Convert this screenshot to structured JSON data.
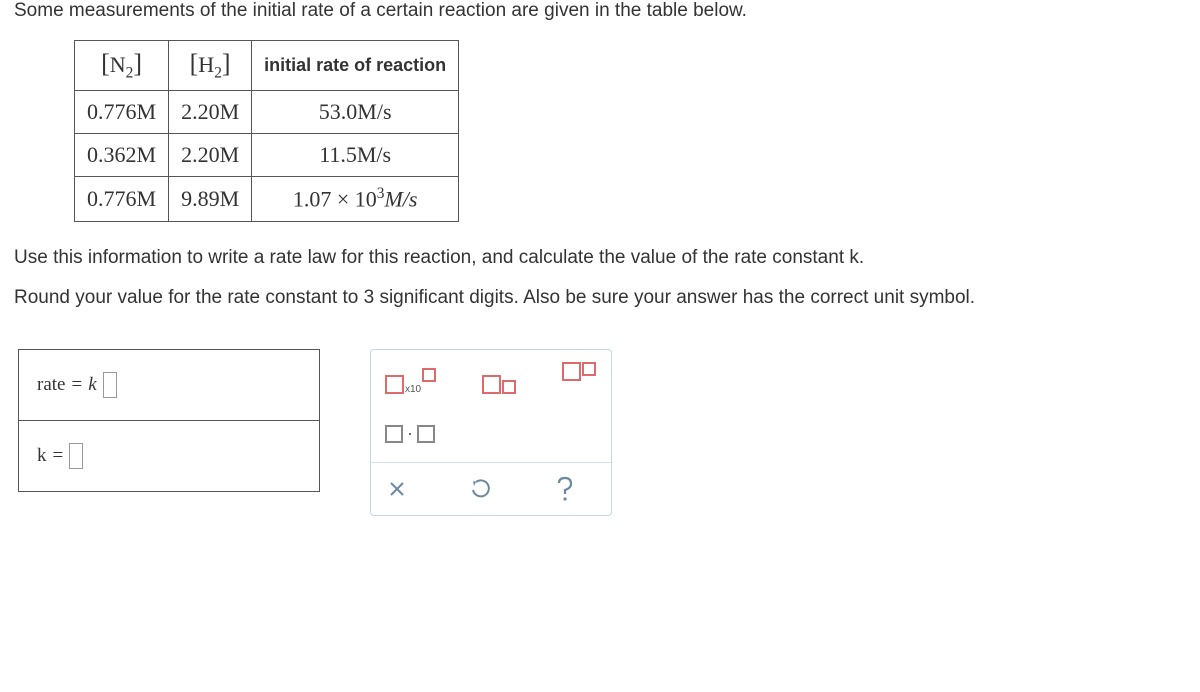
{
  "prompt_pre": "Some measurements of the initial rate of a certain reaction are given in the table below.",
  "table": {
    "headers": {
      "n2_inner": "N",
      "n2_sub": "2",
      "h2_inner": "H",
      "h2_sub": "2",
      "rate": "initial rate of reaction"
    },
    "rows": [
      {
        "n2": "0.776M",
        "h2": "2.20M",
        "rate": "53.0M/s"
      },
      {
        "n2": "0.362M",
        "h2": "2.20M",
        "rate": "11.5M/s"
      },
      {
        "n2": "0.776M",
        "h2": "9.89M",
        "rate_pre": "1.07 × 10",
        "rate_sup": "3",
        "rate_post": "M/s"
      }
    ]
  },
  "prompt_mid": "Use this information to write a rate law for this reaction, and calculate the value of the rate constant k.",
  "prompt_end": "Round your value for the rate constant to 3 significant digits. Also be sure your answer has the correct unit symbol.",
  "answers": {
    "rate_lhs": "rate",
    "eq": "=",
    "rate_k": "k",
    "k_lhs": "k",
    "k_eq": "="
  }
}
